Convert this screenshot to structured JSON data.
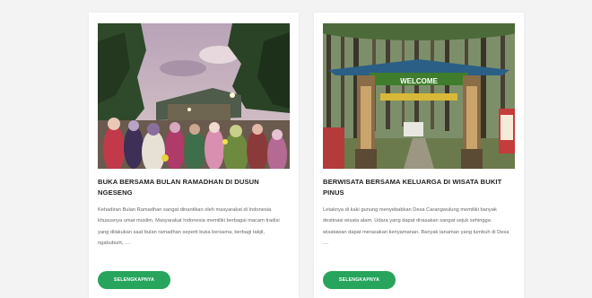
{
  "articles": [
    {
      "title": "BUKA BERSAMA BULAN RAMADHAN DI DUSUN NGESENG",
      "excerpt": "Kehadiran Bulan Ramadhan sangat dinantikan oleh masyarakat di Indonesia khususnya umat muslim. Masyarakat Indonesia memiliki berbagai macam tradisi yang dilakukan saat bulan ramadhan seperti buka bersama, berbagi takjil, ngabuburit, ....",
      "button_label": "SELENGKAPNYA",
      "image": "photo-ramadhan-crowd"
    },
    {
      "title": "BERWISATA BERSAMA KELUARGA DI WISATA BUKIT PINUS",
      "excerpt": "Letaknya di kaki gunung menyebabkan Desa Carangwulung memiliki banyak destinasi wisata alam. Udara yang dapat dirasakan sangat sejuk sehingga wisatawan dapat merasakan kenyamanan. Banyak tanaman yang tumbuh di Desa ....",
      "button_label": "SELENGKAPNYA",
      "image": "photo-pine-forest-gate",
      "gate_text": "WELCOME"
    }
  ],
  "colors": {
    "button": "#27a55d",
    "background": "#f3f3f3",
    "card": "#ffffff"
  }
}
